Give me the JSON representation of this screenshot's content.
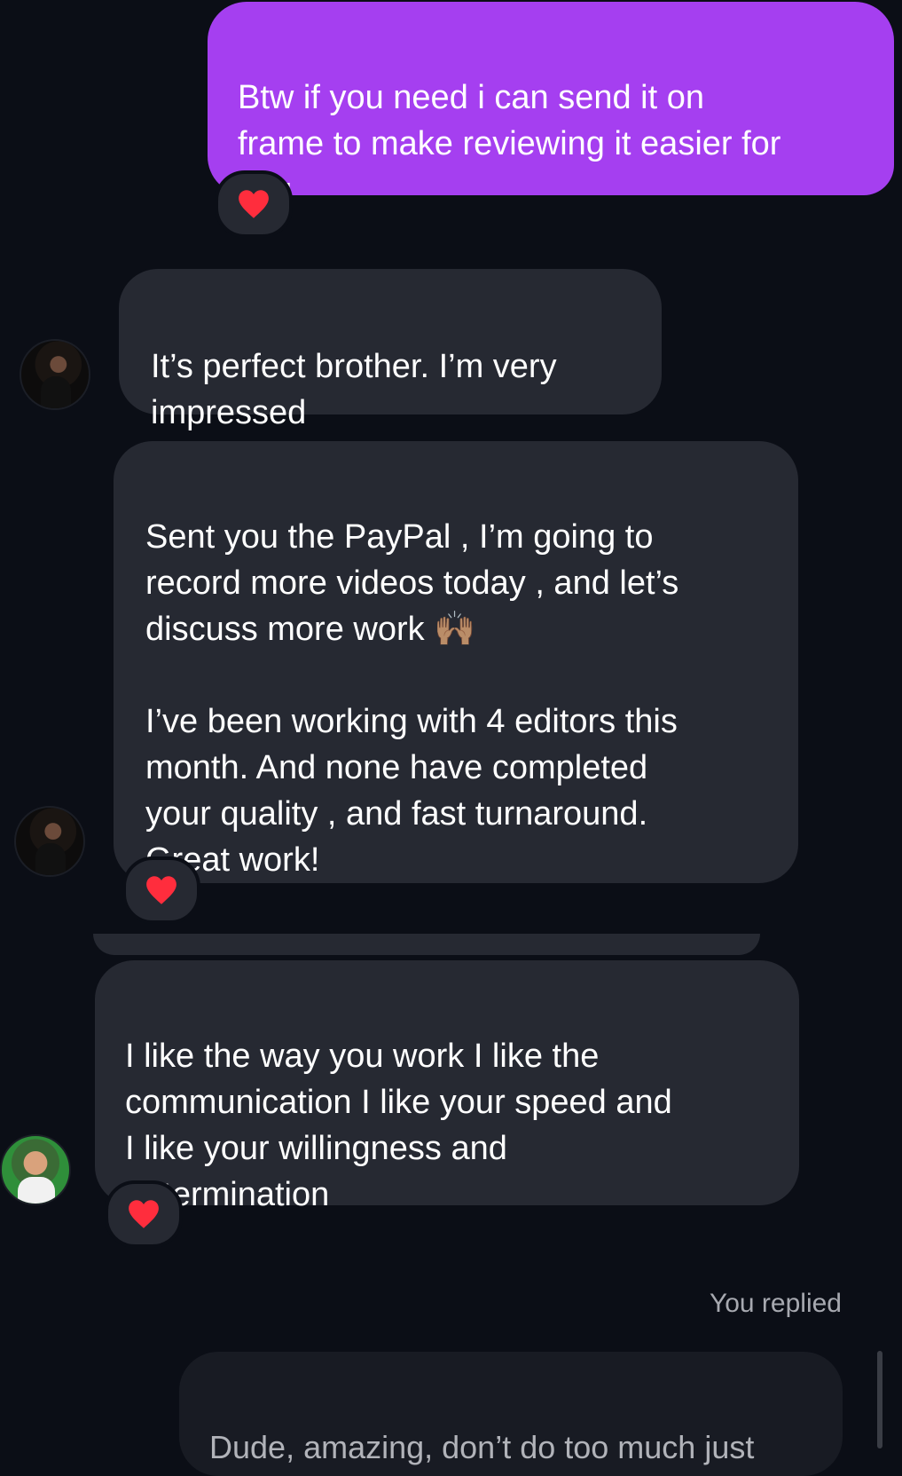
{
  "messages": {
    "m1": {
      "text": "Btw if you need i can send it on\nframe to make reviewing it easier for\nyou"
    },
    "m2": {
      "text": "It’s perfect brother. I’m very\nimpressed"
    },
    "m3": {
      "text": "Sent you the PayPal , I’m going to\nrecord more videos today , and let’s\ndiscuss more work 🙌🏽\n\nI’ve been working with 4 editors this\nmonth. And none have completed\nyour quality , and fast turnaround.\nGreat work!"
    },
    "m4": {
      "text": "I like the way you work I like the\ncommunication I like your speed and\nI like your willingness and\ndetermination"
    }
  },
  "reply": {
    "label": "You replied",
    "quote": "Dude, amazing, don’t do too much just"
  },
  "colors": {
    "background": "#0b0e16",
    "outgoing_bubble": "#a53ff0",
    "incoming_bubble": "#262932",
    "heart": "#ff2d3d"
  },
  "icons": {
    "reaction": "heart-icon"
  }
}
